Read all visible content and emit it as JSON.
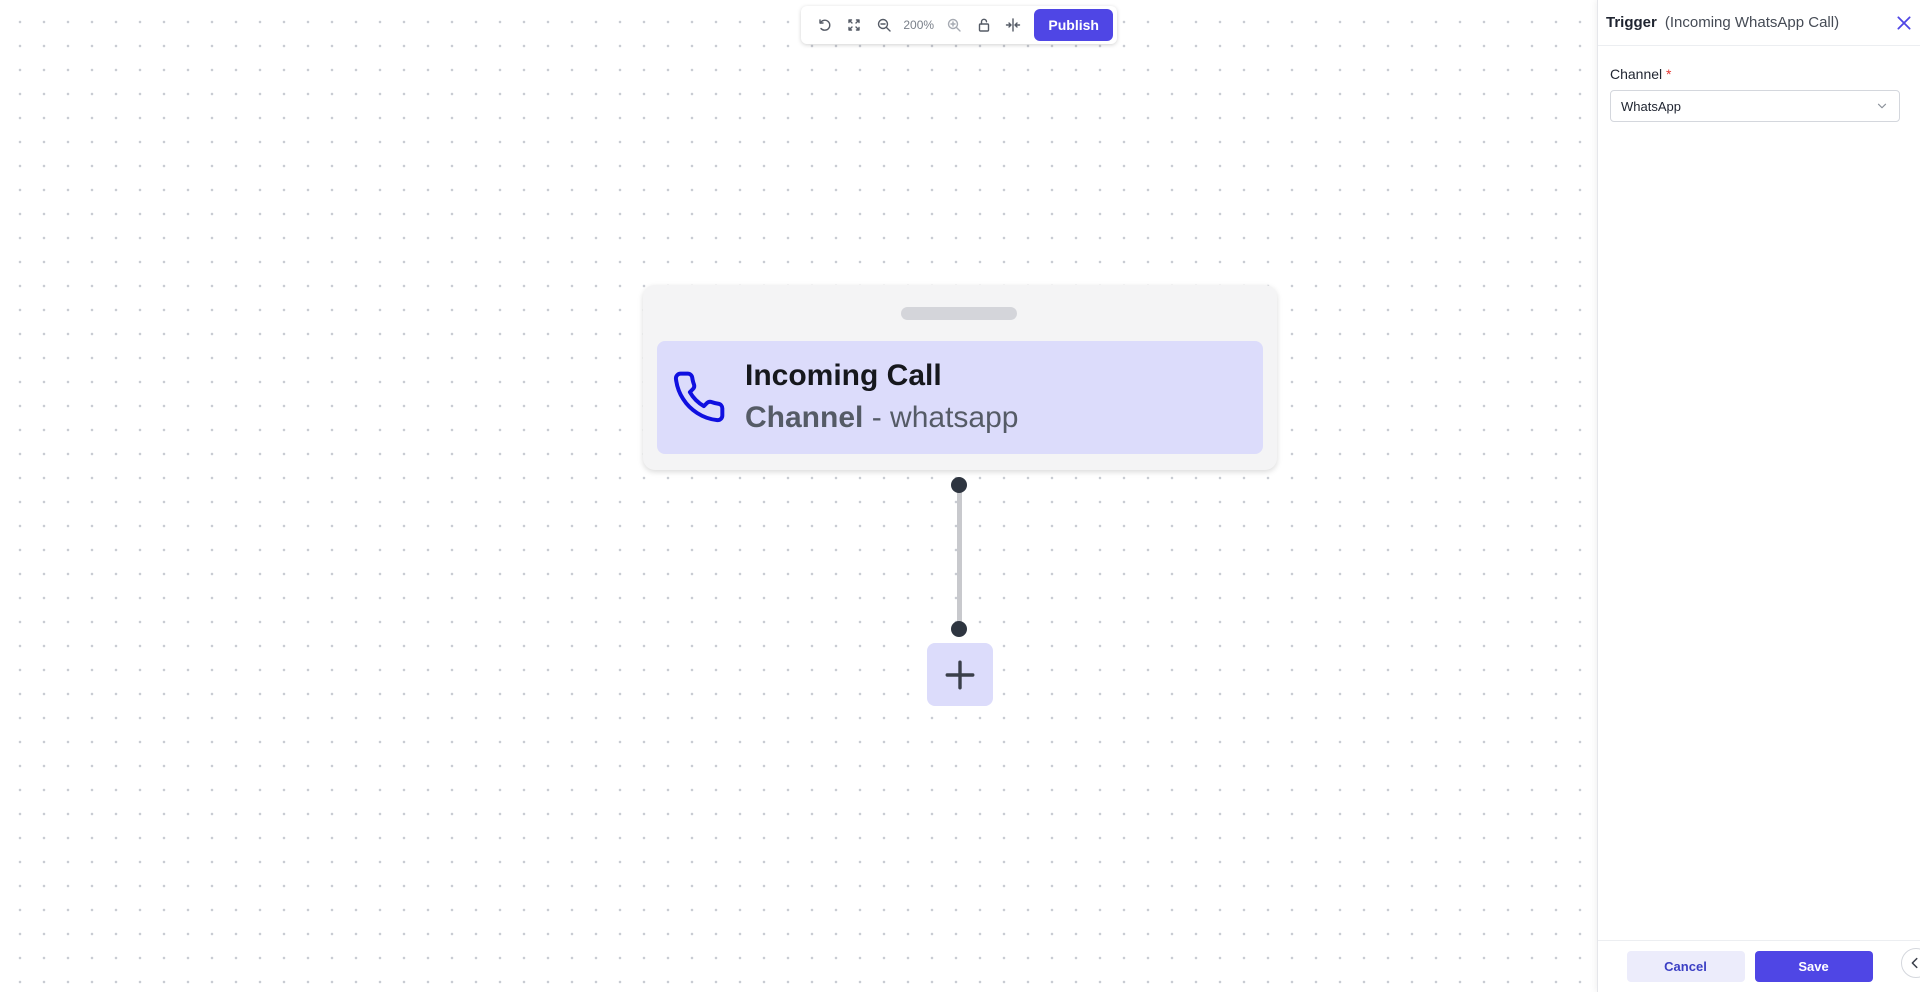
{
  "toolbar": {
    "undo_icon": "undo-icon",
    "fit_icon": "fit-view-icon",
    "zoom_out_icon": "zoom-out-icon",
    "zoom_level": "200%",
    "zoom_in_icon": "zoom-in-icon",
    "lock_icon": "unlock-icon",
    "center_icon": "center-split-icon",
    "publish_label": "Publish"
  },
  "node": {
    "icon": "phone-icon",
    "title": "Incoming Call",
    "channel_label": "Channel",
    "channel_separator": " - ",
    "channel_value": "whatsapp",
    "accent_color": "#1010e0"
  },
  "add_node": {
    "icon": "plus-icon"
  },
  "panel": {
    "title": "Trigger",
    "subtitle": "(Incoming WhatsApp Call)",
    "close_icon": "close-icon",
    "channel_field": {
      "label": "Channel",
      "required_mark": "*",
      "value": "WhatsApp"
    },
    "cancel_label": "Cancel",
    "save_label": "Save",
    "collapse_icon": "chevron-left-icon"
  },
  "colors": {
    "primary": "#4f46e5",
    "node_body": "#dcdcfb",
    "required": "#e53935"
  }
}
